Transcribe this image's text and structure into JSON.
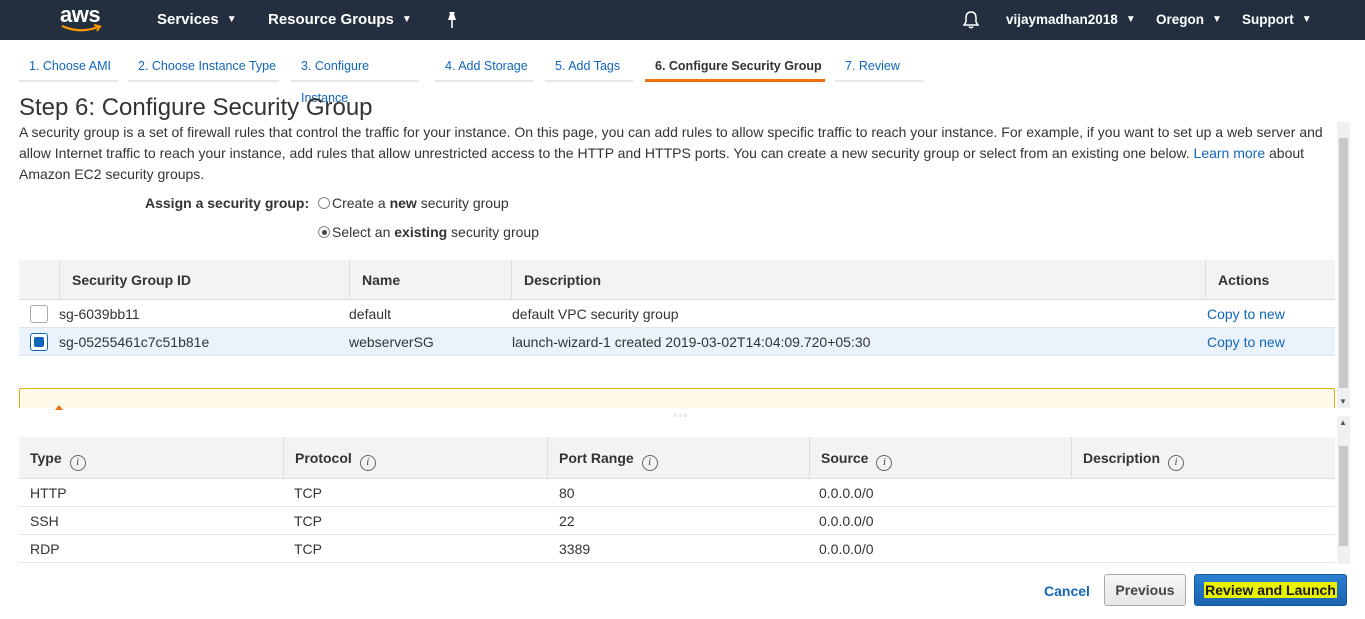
{
  "topnav": {
    "logo": "aws",
    "services": "Services",
    "resource_groups": "Resource Groups",
    "user": "vijaymadhan2018",
    "region": "Oregon",
    "support": "Support"
  },
  "steps": [
    {
      "label": "1. Choose AMI",
      "active": false
    },
    {
      "label": "2. Choose Instance Type",
      "active": false
    },
    {
      "label": "3. Configure Instance",
      "active": false
    },
    {
      "label": "4. Add Storage",
      "active": false
    },
    {
      "label": "5. Add Tags",
      "active": false
    },
    {
      "label": "6. Configure Security Group",
      "active": true
    },
    {
      "label": "7. Review",
      "active": false
    }
  ],
  "page": {
    "title": "Step 6: Configure Security Group",
    "description_part1": "A security group is a set of firewall rules that control the traffic for your instance. On this page, you can add rules to allow specific traffic to reach your instance. For example, if you want to set up a web server and allow Internet traffic to reach your instance, add rules that allow unrestricted access to the HTTP and HTTPS ports. You can create a new security group or select from an existing one below.",
    "learn_more": "Learn more",
    "description_part2": "about Amazon EC2 security groups."
  },
  "assign": {
    "label": "Assign a security group:",
    "option_new_pre": "Create a ",
    "option_new_bold": "new",
    "option_new_post": " security group",
    "option_existing_pre": "Select an ",
    "option_existing_bold": "existing",
    "option_existing_post": " security group",
    "selected": "existing"
  },
  "sg_table": {
    "headers": [
      "Security Group ID",
      "Name",
      "Description",
      "Actions"
    ],
    "rows": [
      {
        "id": "sg-6039bb11",
        "name": "default",
        "description": "default VPC security group",
        "action": "Copy to new",
        "checked": false
      },
      {
        "id": "sg-05255461c7c51b81e",
        "name": "webserverSG",
        "description": "launch-wizard-1 created 2019-03-02T14:04:09.720+05:30",
        "action": "Copy to new",
        "checked": true
      }
    ]
  },
  "rules_table": {
    "headers": [
      "Type",
      "Protocol",
      "Port Range",
      "Source",
      "Description"
    ],
    "rows": [
      {
        "type": "HTTP",
        "protocol": "TCP",
        "port": "80",
        "source": "0.0.0.0/0",
        "description": ""
      },
      {
        "type": "SSH",
        "protocol": "TCP",
        "port": "22",
        "source": "0.0.0.0/0",
        "description": ""
      },
      {
        "type": "RDP",
        "protocol": "TCP",
        "port": "3389",
        "source": "0.0.0.0/0",
        "description": ""
      }
    ]
  },
  "footer": {
    "cancel": "Cancel",
    "previous": "Previous",
    "review_launch": "Review and Launch"
  },
  "colors": {
    "nav_bg": "#232f3e",
    "link": "#1166bb",
    "active_step": "#ec7211",
    "primary_button": "#1a64b0",
    "highlight": "#e9f000"
  }
}
